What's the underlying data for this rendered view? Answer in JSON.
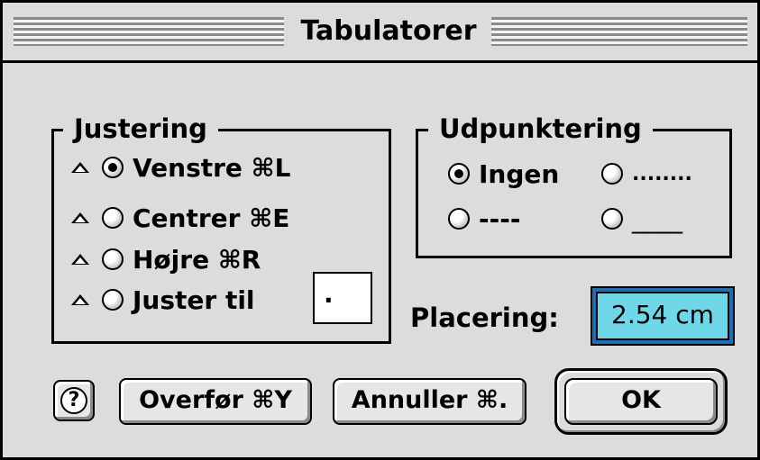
{
  "window": {
    "title": "Tabulatorer"
  },
  "alignment": {
    "group_label": "Justering",
    "options": [
      {
        "label": "Venstre ⌘L",
        "selected": true
      },
      {
        "label": "Centrer ⌘E",
        "selected": false
      },
      {
        "label": "Højre ⌘R",
        "selected": false
      },
      {
        "label": "Juster til",
        "selected": false
      }
    ],
    "align_char": "."
  },
  "leader": {
    "group_label": "Udpunktering",
    "options": [
      {
        "label": "Ingen",
        "selected": true
      },
      {
        "label": "........",
        "selected": false
      },
      {
        "label": "----",
        "selected": false
      },
      {
        "label": "____",
        "selected": false
      }
    ]
  },
  "position": {
    "label": "Placering:",
    "value": "2.54 cm"
  },
  "buttons": {
    "help": "?",
    "overfor": "Overfør ⌘Y",
    "annuller": "Annuller ⌘.",
    "ok": "OK"
  },
  "icons": {
    "align_option_icon": "triangle-up-icon",
    "help_icon": "question-mark-icon"
  }
}
